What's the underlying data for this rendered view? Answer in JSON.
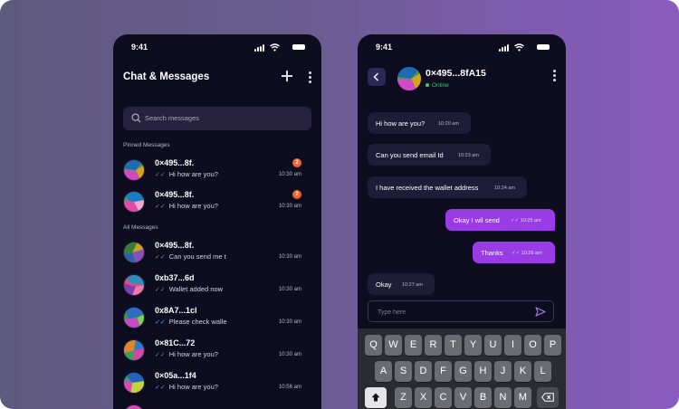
{
  "status_time": "9:41",
  "left": {
    "title": "Chat & Messages",
    "search_placeholder": "Search messages",
    "pinned_label": "Pinned  Messages",
    "all_label": "All Messages",
    "pinned": [
      {
        "name": "0×495...8f.",
        "msg": "Hi how are you?",
        "time": "10:30 am",
        "badge": "2",
        "read": false
      },
      {
        "name": "0×495...8f.",
        "msg": "Hi how are you?",
        "time": "10:30 am",
        "badge": "2",
        "read": false
      }
    ],
    "all": [
      {
        "name": "0×495...8f.",
        "msg": "Can you send me t",
        "time": "10:30 am",
        "read": false
      },
      {
        "name": "0xb37...6d",
        "msg": "Wallet added now",
        "time": "10:30 am",
        "read": false
      },
      {
        "name": "0x8A7...1cl",
        "msg": "Please check walle",
        "time": "10:30 am",
        "read": true
      },
      {
        "name": "0×81C...72",
        "msg": "Hi how are you?",
        "time": "10:30 am",
        "read": false
      },
      {
        "name": "0×05a...1f4",
        "msg": "Hi how are you?",
        "time": "10:56 am",
        "read": false
      }
    ]
  },
  "right": {
    "contact_name": "0×495...8fA15",
    "contact_status": "Online",
    "messages": [
      {
        "dir": "in",
        "text": "Hi how are you?",
        "time": "10:20 am"
      },
      {
        "dir": "in",
        "text": "Can you send email Id",
        "time": "10:23 am"
      },
      {
        "dir": "in",
        "text": "I have received the wallet address",
        "time": "10:24 am"
      },
      {
        "dir": "out",
        "text": "Okay I wil send",
        "time": "10:25 am"
      },
      {
        "dir": "out",
        "text": "Thanks",
        "time": "10:26 am"
      },
      {
        "dir": "in",
        "text": "Okay",
        "time": "10:27 am"
      }
    ],
    "composer_placeholder": "Type here",
    "keyboard": {
      "row1": [
        "Q",
        "W",
        "E",
        "R",
        "T",
        "Y",
        "U",
        "I",
        "O",
        "P"
      ],
      "row2": [
        "A",
        "S",
        "D",
        "F",
        "G",
        "H",
        "J",
        "K",
        "L"
      ],
      "row3": [
        "Z",
        "X",
        "C",
        "V",
        "B",
        "N",
        "M"
      ]
    }
  },
  "colors": {
    "accent": "#9a3ce6",
    "badge": "#f0622d",
    "online": "#3ccb7a",
    "bg": "#0e0c1f"
  }
}
